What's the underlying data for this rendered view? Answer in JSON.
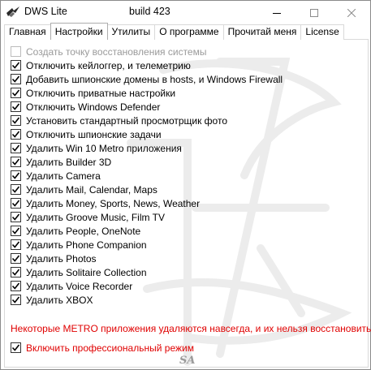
{
  "window": {
    "title": "DWS Lite",
    "build": "build 423"
  },
  "tabs": [
    {
      "label": "Главная",
      "active": false
    },
    {
      "label": "Настройки",
      "active": true
    },
    {
      "label": "Утилиты",
      "active": false
    },
    {
      "label": "О программе",
      "active": false
    },
    {
      "label": "Прочитай меня",
      "active": false
    },
    {
      "label": "License",
      "active": false
    }
  ],
  "settings": {
    "options": [
      {
        "label": "Создать точку восстановления системы",
        "checked": false,
        "enabled": false
      },
      {
        "label": "Отключить кейлоггер, и телеметрию",
        "checked": true,
        "enabled": true
      },
      {
        "label": "Добавить шпионские домены в hosts, и Windows Firewall",
        "checked": true,
        "enabled": true
      },
      {
        "label": "Отключить приватные настройки",
        "checked": true,
        "enabled": true
      },
      {
        "label": "Отключить Windows Defender",
        "checked": true,
        "enabled": true
      },
      {
        "label": "Установить стандартный просмотрщик фото",
        "checked": true,
        "enabled": true
      },
      {
        "label": "Отключить шпионские задачи",
        "checked": true,
        "enabled": true
      },
      {
        "label": "Удалить Win 10 Metro приложения",
        "checked": true,
        "enabled": true
      },
      {
        "label": "Удалить Builder 3D",
        "checked": true,
        "enabled": true
      },
      {
        "label": "Удалить Camera",
        "checked": true,
        "enabled": true
      },
      {
        "label": "Удалить Mail, Calendar, Maps",
        "checked": true,
        "enabled": true
      },
      {
        "label": "Удалить Money, Sports, News, Weather",
        "checked": true,
        "enabled": true
      },
      {
        "label": "Удалить Groove Music, Film TV",
        "checked": true,
        "enabled": true
      },
      {
        "label": "Удалить People, OneNote",
        "checked": true,
        "enabled": true
      },
      {
        "label": "Удалить Phone Companion",
        "checked": true,
        "enabled": true
      },
      {
        "label": "Удалить Photos",
        "checked": true,
        "enabled": true
      },
      {
        "label": "Удалить Solitaire Collection",
        "checked": true,
        "enabled": true
      },
      {
        "label": "Удалить Voice Recorder",
        "checked": true,
        "enabled": true
      },
      {
        "label": "Удалить XBOX",
        "checked": true,
        "enabled": true
      }
    ],
    "warning": "Некоторые METRO приложения удаляются навсегда, и их нельзя восстановить",
    "pro_mode": {
      "label": "Включить профессиональный режим",
      "checked": true
    }
  },
  "signature": "SA",
  "colors": {
    "warning": "#e00000",
    "disabled_text": "#9a9a9a"
  }
}
